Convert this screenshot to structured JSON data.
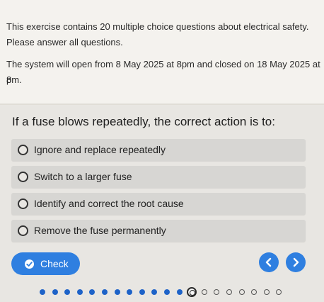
{
  "intro": {
    "line1": "This exercise contains 20 multiple choice questions about electrical safety.",
    "line2": "Please answer all questions.",
    "line3": "The system will open from 8 May 2025 at 8pm and closed on 18 May 2025 at 8",
    "line4": "pm."
  },
  "question": {
    "text": "If a fuse blows repeatedly, the correct action is to:",
    "options": [
      {
        "label": "Ignore and replace repeatedly"
      },
      {
        "label": "Switch to a larger fuse"
      },
      {
        "label": "Identify and correct the root cause"
      },
      {
        "label": "Remove the fuse permanently"
      }
    ]
  },
  "controls": {
    "check_label": "Check",
    "prev_icon": "chevron-left-icon",
    "next_icon": "chevron-right-icon",
    "accent": "#2f7fe0"
  },
  "progress": {
    "total_questions": 20,
    "completed": 12,
    "current": 13
  }
}
